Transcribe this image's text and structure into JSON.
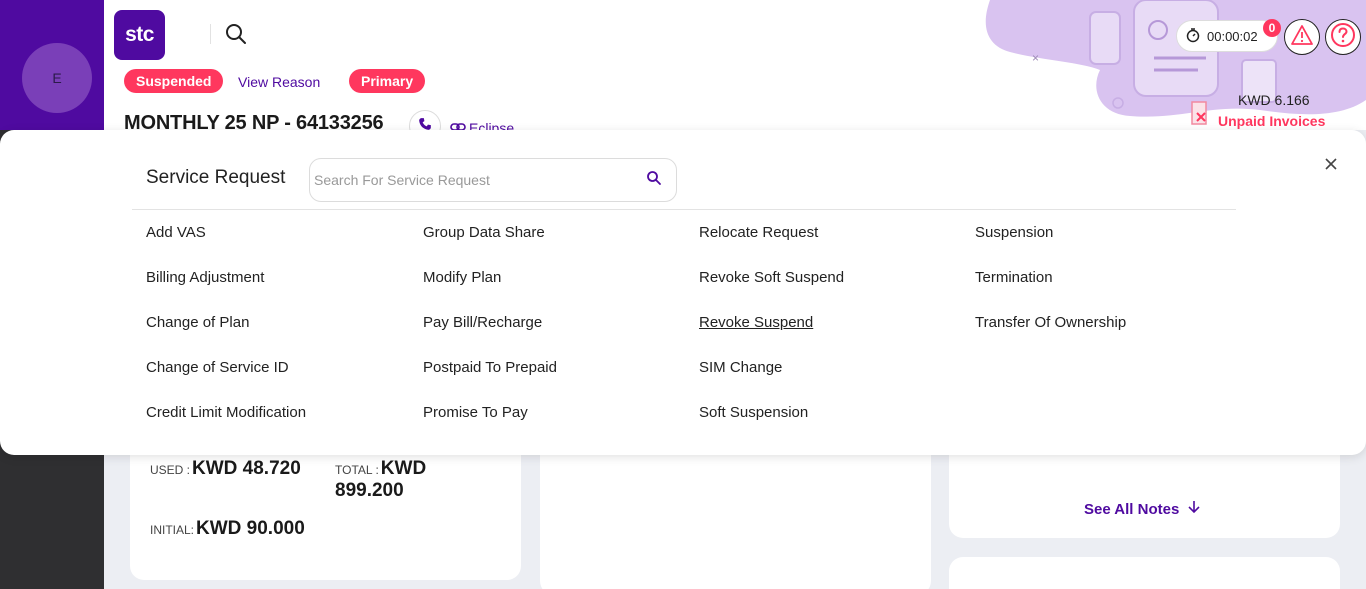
{
  "sidebar": {
    "avatar_initial": "E"
  },
  "header": {
    "logo_text": "stc",
    "status_badge": "Suspended",
    "view_reason_link": "View Reason",
    "primary_badge": "Primary",
    "plan_title": "MONTHLY 25 NP - 64133256",
    "eclipse_link": "Eclipse",
    "timer": "00:00:02",
    "notification_count": "0",
    "balance": "KWD 6.166",
    "unpaid_invoices": "Unpaid Invoices"
  },
  "modal": {
    "title": "Service Request",
    "search_placeholder": "Search For Service Request",
    "columns": [
      [
        "Add VAS",
        "Billing Adjustment",
        "Change of Plan",
        "Change of Service ID",
        "Credit Limit Modification"
      ],
      [
        "Group Data Share",
        "Modify Plan",
        "Pay Bill/Recharge",
        "Postpaid To Prepaid",
        "Promise To Pay"
      ],
      [
        "Relocate Request",
        "Revoke Soft Suspend",
        "Revoke Suspend",
        "SIM Change",
        "Soft Suspension"
      ],
      [
        "Suspension",
        "Termination",
        "Transfer Of Ownership"
      ]
    ]
  },
  "credit": {
    "used_label": "USED :",
    "used_value": "KWD 48.720",
    "total_label": "TOTAL :",
    "total_value_line1": "KWD",
    "total_value_line2": "899.200",
    "initial_label": "INITIAL:",
    "initial_value": "KWD 90.000"
  },
  "notes": {
    "see_all": "See All Notes"
  },
  "colors": {
    "brand": "#4f0aa0",
    "accent": "#ff375e"
  },
  "icons": [
    "search-icon",
    "phone-icon",
    "link-icon",
    "timer-icon",
    "warning-icon",
    "help-icon",
    "close-icon",
    "invoice-icon",
    "arrow-down-icon"
  ]
}
